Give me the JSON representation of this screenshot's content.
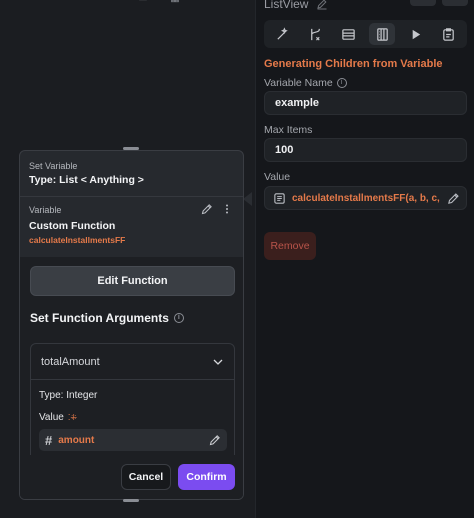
{
  "colors": {
    "accent": "#e57a4a",
    "confirm": "#7b4cf0",
    "danger": "#b9544a"
  },
  "panel": {
    "title": "ListView",
    "tabs": [
      "magic-wand-icon",
      "branch-icon",
      "table-icon",
      "list-items-icon",
      "play-icon",
      "clipboard-icon"
    ],
    "section_title": "Generating Children from Variable",
    "variable_name_label": "Variable Name",
    "variable_name_value": "example",
    "max_items_label": "Max Items",
    "max_items_value": "100",
    "value_label": "Value",
    "value_function": "calculateInstallmentsFF(a, b, c, ...)",
    "remove_label": "Remove"
  },
  "modal": {
    "set_variable_label": "Set Variable",
    "type_label": "Type: List < Anything >",
    "variable_label": "Variable",
    "custom_function_label": "Custom Function",
    "function_name": "calculateInstallmentsFF",
    "edit_function_label": "Edit Function",
    "args_title": "Set Function Arguments",
    "argument": {
      "name": "totalAmount",
      "type": "Type: Integer",
      "value_label": "Value",
      "value": "amount"
    },
    "cancel_label": "Cancel",
    "confirm_label": "Confirm"
  }
}
